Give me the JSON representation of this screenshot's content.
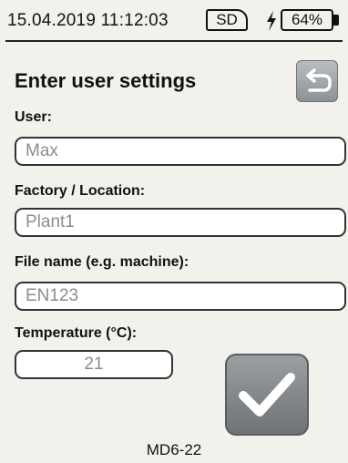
{
  "status": {
    "datetime": "15.04.2019 11:12:03",
    "sd_label": "SD",
    "battery": "64%"
  },
  "page": {
    "title": "Enter user settings",
    "back_icon": "back-arrow-icon",
    "confirm_icon": "checkmark-icon"
  },
  "fields": {
    "user": {
      "label": "User:",
      "value": "Max"
    },
    "location": {
      "label": "Factory / Location:",
      "value": "Plant1"
    },
    "file": {
      "label": "File name (e.g. machine):",
      "value": "EN123"
    },
    "temperature": {
      "label": "Temperature (°C):",
      "value": "21"
    }
  },
  "footer": {
    "code": "MD6-22"
  },
  "colors": {
    "background": "#f3f1ec",
    "button_gray": "#8c9296",
    "value_text": "#8d8d8d"
  }
}
